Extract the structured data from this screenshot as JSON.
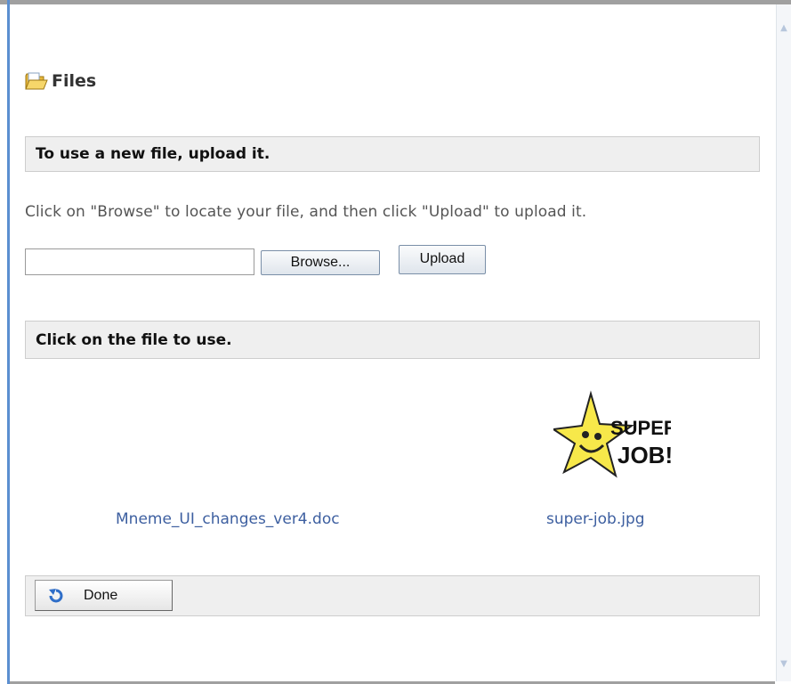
{
  "title": "Files",
  "upload_section": {
    "heading": "To use a new file, upload it.",
    "instructions": "Click on \"Browse\" to locate your file, and then click \"Upload\" to upload it.",
    "file_input_value": "",
    "browse_label": "Browse...",
    "upload_label": "Upload"
  },
  "files_section": {
    "heading": "Click on the file to use.",
    "files": [
      {
        "name": "Mneme_UI_changes_ver4.doc",
        "icon": "document-icon"
      },
      {
        "name": "super-job.jpg",
        "icon": "image-thumbnail",
        "thumbnail_text": [
          "SUPER",
          "JOB!"
        ]
      }
    ]
  },
  "footer": {
    "done_label": "Done"
  },
  "colors": {
    "link": "#3d5fa0",
    "section_bg": "#efefef",
    "accent": "#5b8fd0"
  }
}
